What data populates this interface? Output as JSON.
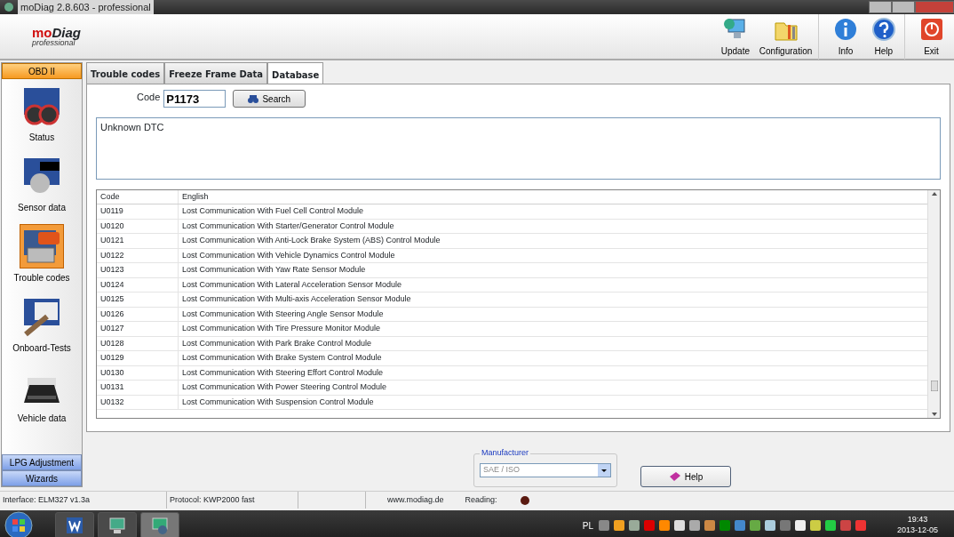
{
  "window": {
    "title": "moDiag 2.8.603 - professional"
  },
  "logo": {
    "brand_red": "mo",
    "brand_black": "Diag",
    "edition": "professional"
  },
  "toolbar": [
    {
      "label": "Update",
      "kind": "update"
    },
    {
      "label": "Configuration",
      "kind": "config"
    },
    {
      "label": "Info",
      "kind": "info"
    },
    {
      "label": "Help",
      "kind": "help"
    },
    {
      "label": "Exit",
      "kind": "exit"
    }
  ],
  "sidebar": {
    "sections": [
      {
        "label": "OBD II",
        "selected": true
      },
      {
        "label": "LPG Adjustment",
        "selected": false
      },
      {
        "label": "Wizards",
        "selected": false
      }
    ],
    "items": [
      {
        "label": "Status",
        "selected": false,
        "kind": "status"
      },
      {
        "label": "Sensor data",
        "selected": false,
        "kind": "sensor"
      },
      {
        "label": "Trouble codes",
        "selected": true,
        "kind": "codes"
      },
      {
        "label": "Onboard-Tests",
        "selected": false,
        "kind": "tests"
      },
      {
        "label": "Vehicle data",
        "selected": false,
        "kind": "vehicle"
      }
    ]
  },
  "tabs": [
    {
      "label": "Trouble codes",
      "selected": false
    },
    {
      "label": "Freeze Frame Data",
      "selected": false
    },
    {
      "label": "Database",
      "selected": true
    }
  ],
  "search": {
    "label": "Code",
    "value": "P1173",
    "button": "Search"
  },
  "result": "Unknown DTC",
  "table": {
    "columns": [
      "Code",
      "English"
    ],
    "rows": [
      [
        "U0119",
        "Lost Communication With Fuel Cell Control Module"
      ],
      [
        "U0120",
        "Lost Communication With Starter/Generator Control Module"
      ],
      [
        "U0121",
        "Lost Communication With Anti-Lock Brake System (ABS) Control Module"
      ],
      [
        "U0122",
        "Lost Communication With Vehicle Dynamics Control Module"
      ],
      [
        "U0123",
        "Lost Communication With Yaw Rate Sensor Module"
      ],
      [
        "U0124",
        "Lost Communication With Lateral Acceleration Sensor Module"
      ],
      [
        "U0125",
        "Lost Communication With Multi-axis Acceleration Sensor Module"
      ],
      [
        "U0126",
        "Lost Communication With Steering Angle Sensor Module"
      ],
      [
        "U0127",
        "Lost Communication With Tire Pressure Monitor Module"
      ],
      [
        "U0128",
        "Lost Communication With Park Brake Control Module"
      ],
      [
        "U0129",
        "Lost Communication With Brake System Control Module"
      ],
      [
        "U0130",
        "Lost Communication With Steering Effort Control Module"
      ],
      [
        "U0131",
        "Lost Communication With Power Steering Control Module"
      ],
      [
        "U0132",
        "Lost Communication With Suspension Control Module"
      ]
    ]
  },
  "manufacturer": {
    "legend": "Manufacturer",
    "value": "SAE / ISO",
    "disabled": true
  },
  "help_button": "Help",
  "status_bar": {
    "interface": "Interface: ELM327 v1.3a",
    "protocol": "Protocol: KWP2000 fast",
    "website": "www.modiag.de",
    "reading_label": "Reading:",
    "reading_active": false
  },
  "taskbar": {
    "language": "PL",
    "time": "19:43",
    "date": "2013-12-05"
  }
}
